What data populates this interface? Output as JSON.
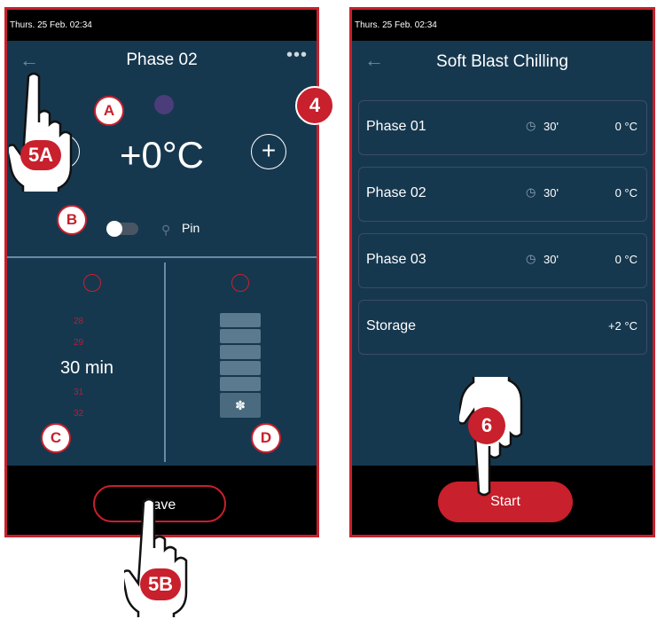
{
  "screen1": {
    "status_time": "Thurs. 25 Feb. 02:34",
    "title": "Phase 02",
    "more": "•••",
    "temperature": "+0°C",
    "plus": "+",
    "pin_label": "Pin",
    "time_list": [
      "28",
      "29",
      "31",
      "32"
    ],
    "time_value": "30",
    "time_unit": "min",
    "save_label": "Save"
  },
  "screen2": {
    "status_time": "Thurs. 25 Feb. 02:34",
    "title": "Soft Blast Chilling",
    "phases": [
      {
        "name": "Phase 01",
        "time": "30'",
        "temp": "0 °C"
      },
      {
        "name": "Phase 02",
        "time": "30'",
        "temp": "0 °C"
      },
      {
        "name": "Phase 03",
        "time": "30'",
        "temp": "0 °C"
      },
      {
        "name": "Storage",
        "time": "",
        "temp": "+2 °C"
      }
    ],
    "start_label": "Start"
  },
  "annotations": {
    "a": "A",
    "b": "B",
    "c": "C",
    "d": "D",
    "step4": "4",
    "step5a": "5A",
    "step5b": "5B",
    "step6": "6"
  },
  "colors": {
    "screen_bg": "#16384f",
    "accent_red": "#c8202c",
    "status_bar": "#000000"
  }
}
